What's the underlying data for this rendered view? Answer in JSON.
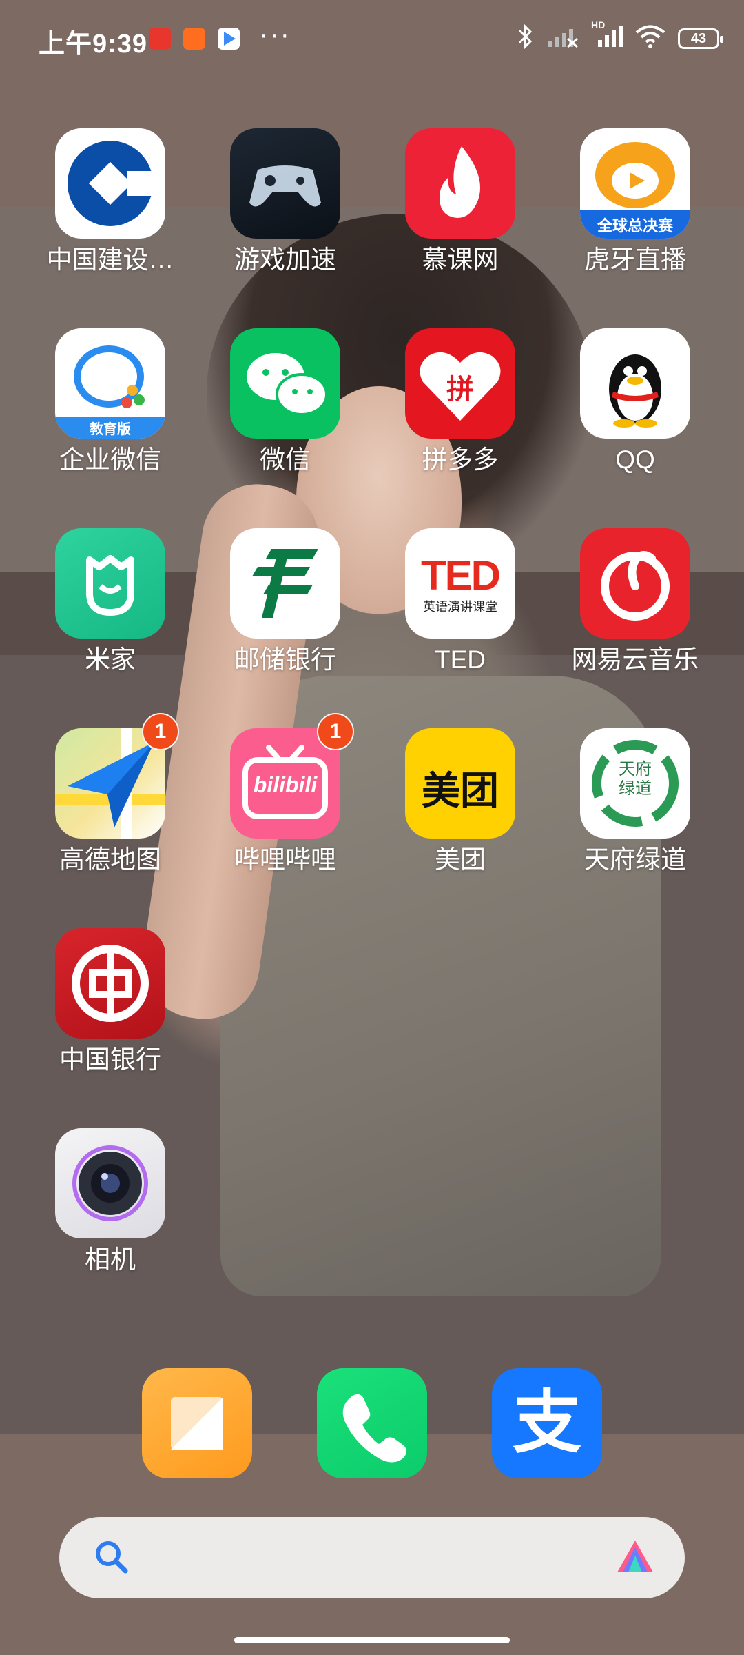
{
  "status_bar": {
    "time": "上午9:39",
    "ellipsis": "···",
    "battery": "43",
    "network_label": "HD"
  },
  "apps": [
    {
      "label": "中国建设…",
      "icon": "ccb-icon"
    },
    {
      "label": "游戏加速",
      "icon": "gamepad-icon"
    },
    {
      "label": "慕课网",
      "icon": "flame-icon"
    },
    {
      "label": "虎牙直播",
      "icon": "huya-tiger-icon",
      "icon_text": "全球总决赛"
    },
    {
      "label": "企业微信",
      "icon": "wecom-icon",
      "icon_text": "教育版"
    },
    {
      "label": "微信",
      "icon": "wechat-icon"
    },
    {
      "label": "拼多多",
      "icon": "pinduoduo-icon",
      "icon_text": "拼"
    },
    {
      "label": "QQ",
      "icon": "qq-penguin-icon"
    },
    {
      "label": "米家",
      "icon": "mijia-icon"
    },
    {
      "label": "邮储银行",
      "icon": "psbc-icon"
    },
    {
      "label": "TED",
      "icon": "ted-icon",
      "icon_text": "TED",
      "icon_subtext": "英语演讲课堂"
    },
    {
      "label": "网易云音乐",
      "icon": "netease-music-icon"
    },
    {
      "label": "高德地图",
      "icon": "amap-icon",
      "badge": "1"
    },
    {
      "label": "哔哩哔哩",
      "icon": "bilibili-icon",
      "badge": "1",
      "icon_text": "bilibili"
    },
    {
      "label": "美团",
      "icon": "meituan-icon",
      "icon_text": "美团"
    },
    {
      "label": "天府绿道",
      "icon": "tianfu-greenway-icon",
      "icon_text": "天府绿道"
    },
    {
      "label": "中国银行",
      "icon": "boc-icon"
    },
    {
      "label": "相机",
      "icon": "camera-icon"
    }
  ],
  "dock": [
    {
      "name": "notes",
      "icon": "notes-icon"
    },
    {
      "name": "phone",
      "icon": "phone-icon"
    },
    {
      "name": "alipay",
      "icon": "alipay-icon",
      "icon_text": "支"
    }
  ],
  "search": {
    "placeholder": ""
  },
  "colors": {
    "badge": "#f04a1a",
    "wallpaper": "#7d6a63"
  }
}
